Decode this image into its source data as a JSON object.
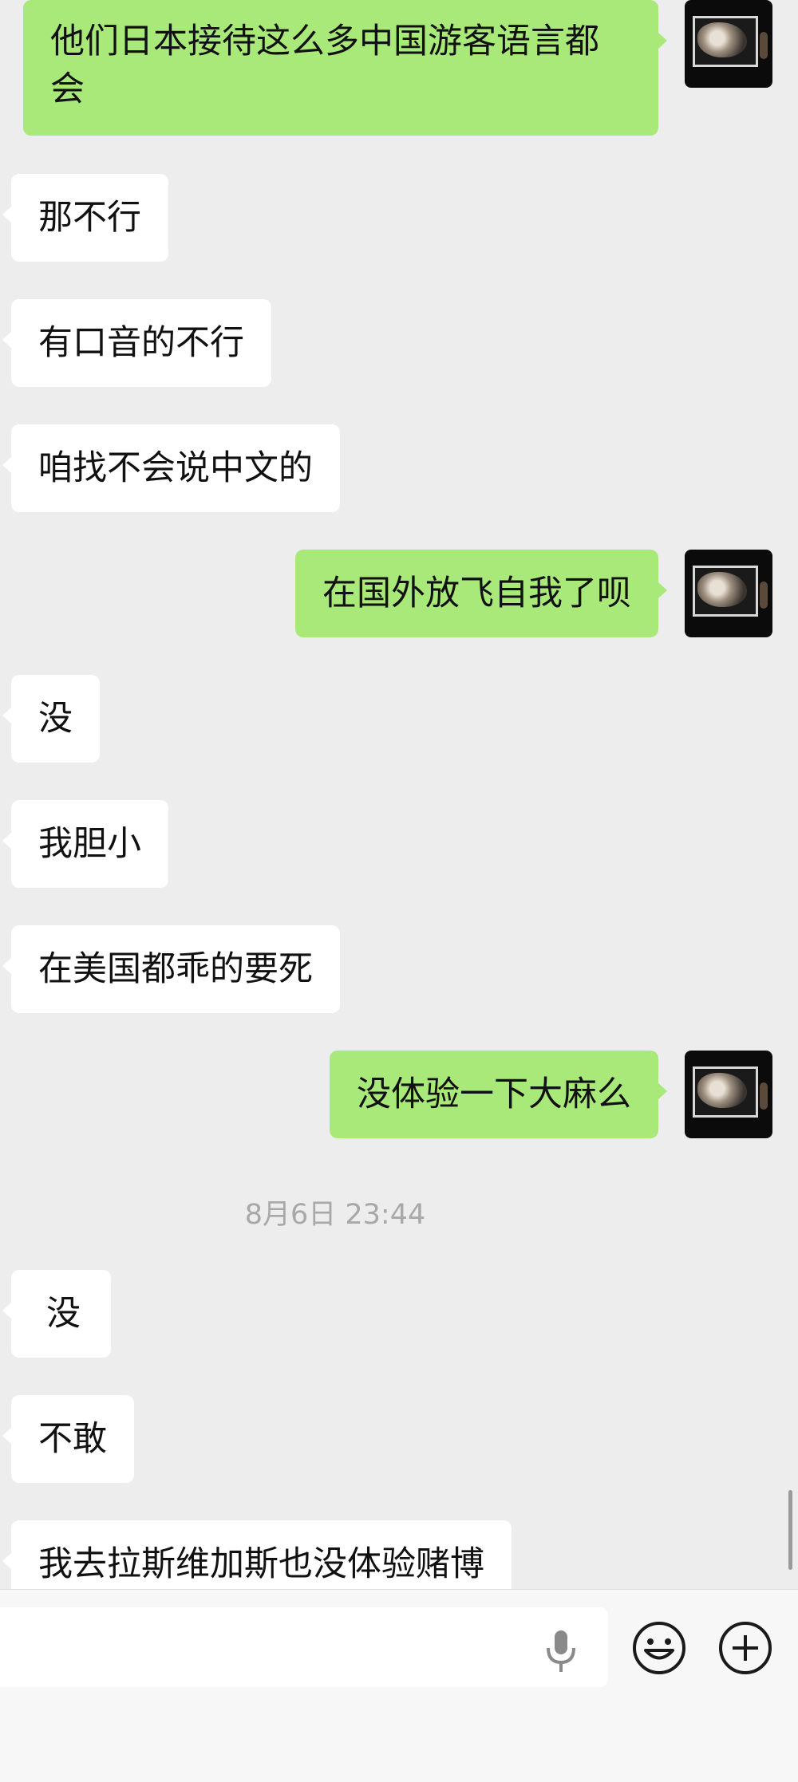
{
  "messages": [
    {
      "side": "out",
      "text": "他们日本接待这么多中国游客语言都会"
    },
    {
      "side": "in",
      "text": "那不行"
    },
    {
      "side": "in",
      "text": "有口音的不行"
    },
    {
      "side": "in",
      "text": "咱找不会说中文的"
    },
    {
      "side": "out",
      "text": "在国外放飞自我了呗"
    },
    {
      "side": "in",
      "text": "没"
    },
    {
      "side": "in",
      "text": "我胆小"
    },
    {
      "side": "in",
      "text": "在美国都乖的要死"
    },
    {
      "side": "out",
      "text": "没体验一下大麻么"
    },
    {
      "side": "in",
      "text": "没"
    },
    {
      "side": "in",
      "text": "不敢"
    },
    {
      "side": "in",
      "text": "我去拉斯维加斯也没体验赌博"
    }
  ],
  "timestamp": "8月6日 23:44",
  "input": {
    "placeholder": ""
  },
  "icons": {
    "mic": "microphone-icon",
    "emoji": "emoji-icon",
    "plus": "plus-icon",
    "avatar": "avatar-image"
  },
  "colors": {
    "background": "#ededed",
    "outgoing_bubble": "#a9e97a",
    "incoming_bubble": "#ffffff"
  }
}
